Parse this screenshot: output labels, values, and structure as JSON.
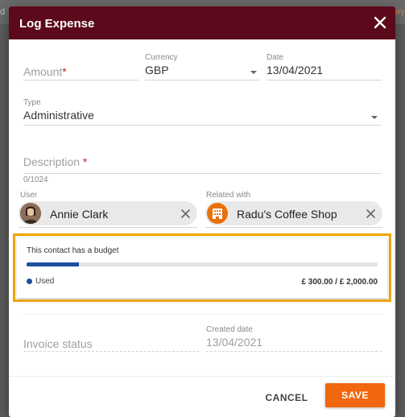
{
  "background": {
    "left_fragment": "d",
    "right_fragment": "ery"
  },
  "dialog": {
    "title": "Log Expense",
    "header_color": "#5c0a1b"
  },
  "form": {
    "amount": {
      "placeholder": "Amount",
      "required_mark": "*"
    },
    "currency": {
      "label": "Currency",
      "value": "GBP"
    },
    "date": {
      "label": "Date",
      "value": "13/04/2021"
    },
    "type": {
      "label": "Type",
      "value": "Administrative"
    },
    "description": {
      "placeholder": "Description",
      "required_mark": "*",
      "counter": "0/1024"
    },
    "user": {
      "label": "User",
      "value": "Annie Clark"
    },
    "related": {
      "label": "Related with",
      "value": "Radu's Coffee Shop"
    },
    "invoice_status": {
      "placeholder": "Invoice status"
    },
    "created_date": {
      "label": "Created date",
      "value": "13/04/2021"
    }
  },
  "budget": {
    "title": "This contact has a budget",
    "used_label": "Used",
    "used_fraction": 0.15,
    "amount_text": "£ 300.00 / £ 2,000.00",
    "fill_color": "#1e4fa0",
    "highlight_color": "#f0a500"
  },
  "footer": {
    "cancel_label": "CANCEL",
    "save_label": "SAVE",
    "save_color": "#f0670e"
  },
  "icons": {
    "close": "close-icon",
    "chevron": "chevron-down-icon",
    "chip_remove": "clear-icon",
    "avatar": "user-avatar",
    "organization": "building-icon"
  }
}
